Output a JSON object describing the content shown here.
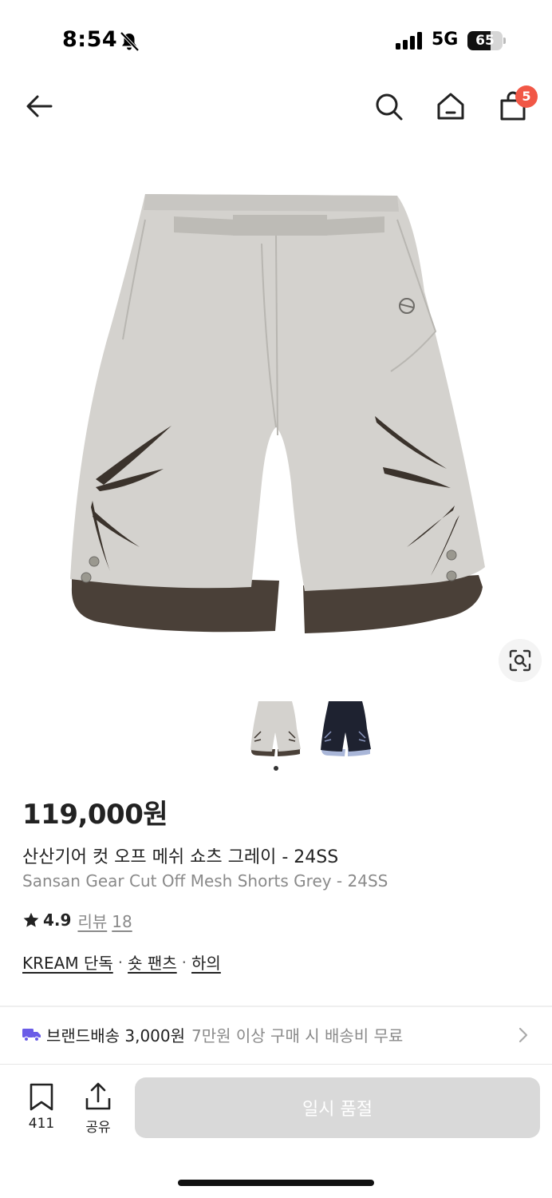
{
  "status_bar": {
    "time": "8:54",
    "network": "5G",
    "battery_level": "65",
    "battery_fraction": 0.65,
    "icons": [
      "bell-slash-icon",
      "cellular-signal-icon",
      "battery-icon"
    ]
  },
  "nav": {
    "icons": [
      "arrow-left-icon",
      "search-icon",
      "home-icon",
      "shopping-bag-icon"
    ],
    "cart_badge": "5"
  },
  "gallery": {
    "main_image": "grey-mesh-shorts",
    "thumbnails": [
      "grey-shorts",
      "black-shorts"
    ],
    "active_index": 0,
    "lens_icon": "image-search-icon"
  },
  "product": {
    "price": "119,000원",
    "name_ko": "산산기어 컷 오프 메쉬 쇼츠 그레이 - 24SS",
    "name_en": "Sansan Gear Cut Off Mesh Shorts Grey - 24SS",
    "rating": "4.9",
    "review_label": "리뷰",
    "review_count": "18",
    "tags": [
      "KREAM 단독",
      "숏 팬츠",
      "하의"
    ],
    "tag_separator": "·"
  },
  "shipping": {
    "label": "브랜드배송 3,000원",
    "detail": "7만원 이상 구매 시 배송비 무료",
    "icon": "truck-icon",
    "accent_color": "#6a5ce7"
  },
  "bottom_bar": {
    "bookmark_count": "411",
    "share_label": "공유",
    "primary_button": "일시 품절"
  },
  "colors": {
    "badge": "#f15746",
    "soldout_button": "#d9d9d9"
  }
}
